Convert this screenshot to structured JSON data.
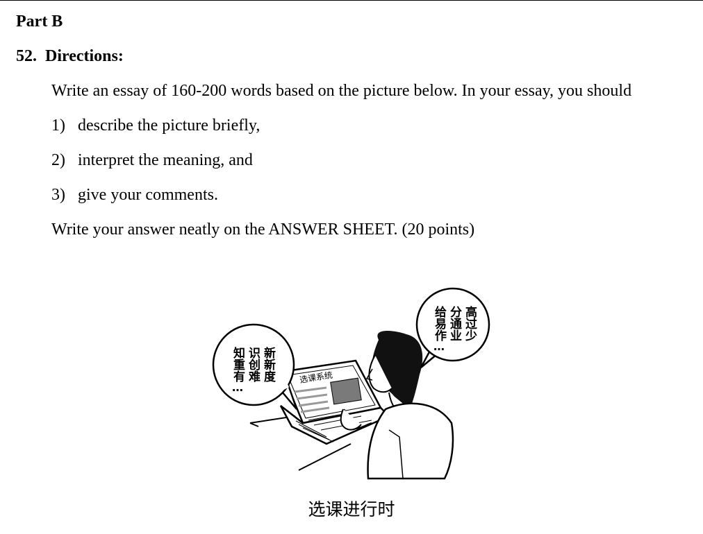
{
  "section": {
    "part_label": "Part B"
  },
  "question": {
    "number": "52.",
    "heading": "Directions:",
    "intro": "Write an essay of 160-200 words based on the picture below. In your essay, you should",
    "items": [
      {
        "marker": "1)",
        "text": "describe the picture briefly,"
      },
      {
        "marker": "2)",
        "text": "interpret the meaning, and"
      },
      {
        "marker": "3)",
        "text": "give your comments."
      }
    ],
    "closing": "Write your answer neatly on the ANSWER SHEET. (20 points)"
  },
  "figure": {
    "left_bubble_columns": [
      "新新度",
      "识创难",
      "知重有"
    ],
    "left_bubble_dots": "…",
    "right_bubble_columns": [
      "高过少",
      "分通业",
      "给易作"
    ],
    "right_bubble_dots": "…",
    "screen_label": "选课系统",
    "caption": "选课进行时"
  }
}
